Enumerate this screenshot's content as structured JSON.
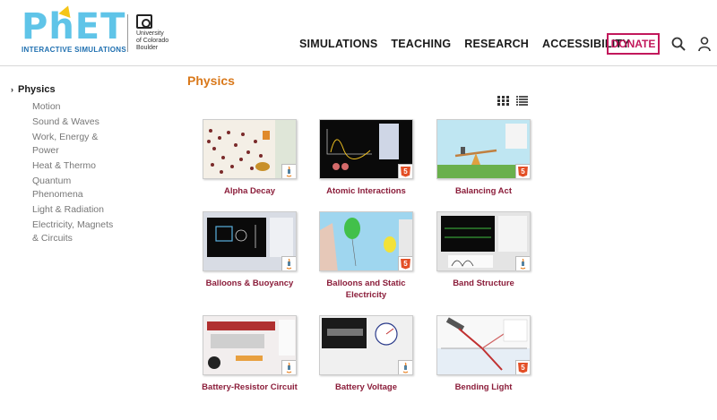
{
  "header": {
    "logo_text": "PhET",
    "logo_subtitle": "INTERACTIVE SIMULATIONS",
    "university_lines": [
      "University",
      "of Colorado",
      "Boulder"
    ],
    "nav": [
      "SIMULATIONS",
      "TEACHING",
      "RESEARCH",
      "ACCESSIBILITY"
    ],
    "donate_label": "DONATE",
    "search_icon": "search-icon",
    "user_icon": "user-icon"
  },
  "sidebar": {
    "active": "Physics",
    "items": [
      "Motion",
      "Sound & Waves",
      "Work, Energy & Power",
      "Heat & Thermo",
      "Quantum Phenomena",
      "Light & Radiation",
      "Electricity, Magnets & Circuits"
    ]
  },
  "main": {
    "title": "Physics",
    "view_icons": [
      "grid-view-icon",
      "list-view-icon"
    ],
    "sims": [
      {
        "name": "Alpha Decay",
        "tech": "java"
      },
      {
        "name": "Atomic Interactions",
        "tech": "html5"
      },
      {
        "name": "Balancing Act",
        "tech": "html5"
      },
      {
        "name": "Balloons & Buoyancy",
        "tech": "java"
      },
      {
        "name": "Balloons and Static Electricity",
        "tech": "html5"
      },
      {
        "name": "Band Structure",
        "tech": "java"
      },
      {
        "name": "Battery-Resistor Circuit",
        "tech": "java"
      },
      {
        "name": "Battery Voltage",
        "tech": "java"
      },
      {
        "name": "Bending Light",
        "tech": "html5"
      }
    ],
    "html5_badge_text": "5"
  },
  "colors": {
    "accent": "#d9781a",
    "sim_title": "#8b1d3a",
    "donate": "#c2185b",
    "phet_light_blue": "#5fc4e8",
    "phet_dark_blue": "#1e6fb0"
  }
}
